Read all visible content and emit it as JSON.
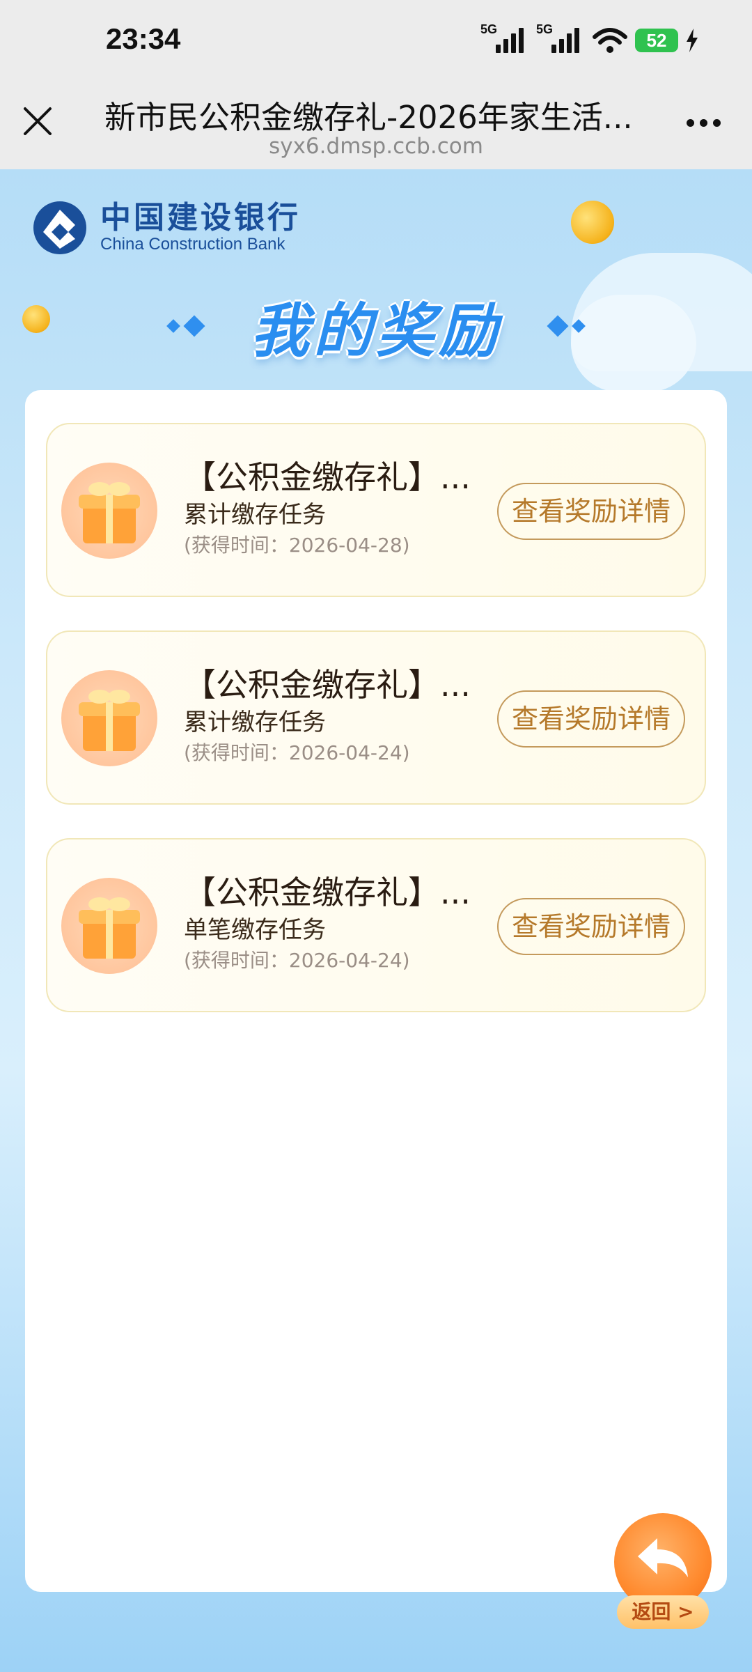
{
  "status_bar": {
    "time": "23:34",
    "signal1_tag": "5G",
    "signal2_tag": "5G",
    "battery": "52",
    "icons": [
      "signal-icon",
      "signal-icon",
      "wifi-icon",
      "battery-icon",
      "charging-icon"
    ]
  },
  "browser": {
    "title": "新市民公积金缴存礼-2026年家生活...",
    "url": "syx6.dmsp.ccb.com",
    "close_icon": "close-icon",
    "more_icon": "more-icon"
  },
  "brand": {
    "name_cn": "中国建设银行",
    "name_en": "China Construction Bank",
    "color": "#1a4f9a"
  },
  "page_heading": "我的奖励",
  "rewards": [
    {
      "title": "【公积金缴存礼】...",
      "task": "累计缴存任务",
      "time": "(获得时间：2026-04-28)",
      "button": "查看奖励详情"
    },
    {
      "title": "【公积金缴存礼】...",
      "task": "累计缴存任务",
      "time": "(获得时间：2026-04-24)",
      "button": "查看奖励详情"
    },
    {
      "title": "【公积金缴存礼】...",
      "task": "单笔缴存任务",
      "time": "(获得时间：2026-04-24)",
      "button": "查看奖励详情"
    }
  ],
  "back_button": {
    "label": "返回 >",
    "icon": "back-arrow-icon"
  },
  "colors": {
    "accent_blue": "#2a8ef0",
    "button_gold": "#b5792a",
    "back_orange": "#ff8a2e"
  }
}
